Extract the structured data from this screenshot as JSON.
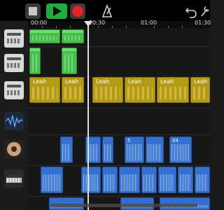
{
  "toolbar": {
    "stop": "stop-icon",
    "play": "play-icon",
    "record": "record-icon",
    "metronome": "metronome-icon",
    "undo": "undo-icon",
    "settings": "wrench-icon"
  },
  "ruler": {
    "labels": [
      "00:00",
      "00:30",
      "01:00",
      "01:30"
    ]
  },
  "tracks": [
    {
      "icon": "drum-machine-icon"
    },
    {
      "icon": "drum-machine-icon"
    },
    {
      "icon": "drum-machine-icon"
    },
    {
      "icon": "waveform-icon"
    },
    {
      "icon": "guitar-icon"
    },
    {
      "icon": "keyboard-icon"
    }
  ],
  "regions": {
    "lead": [
      "Leah",
      "Leah",
      "Leah",
      "Leah",
      "Leah",
      "Leah"
    ],
    "audio_a": [
      "5",
      "04"
    ]
  },
  "colors": {
    "play": "#1fae3c",
    "record": "#e0242a",
    "drums": "#45c04a",
    "lead": "#b59a16",
    "audio": "#3470d0"
  }
}
